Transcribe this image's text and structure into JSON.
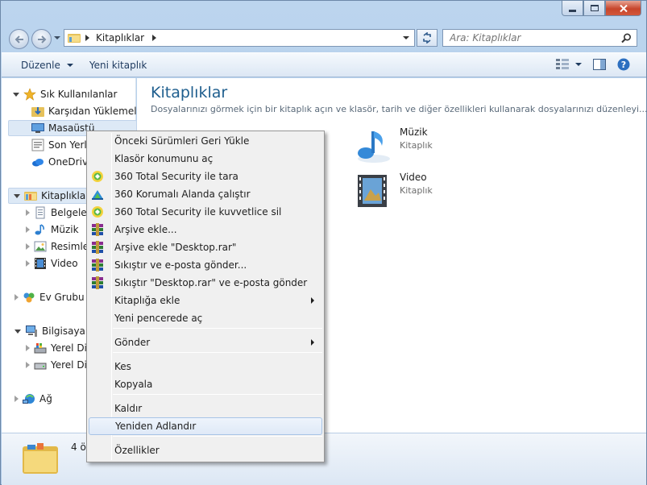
{
  "window": {
    "caption_buttons": [
      "minimize-icon",
      "maximize-icon",
      "close-icon"
    ]
  },
  "address": {
    "path": [
      "Kitaplıklar"
    ]
  },
  "search": {
    "placeholder": "Ara: Kitaplıklar"
  },
  "toolbar": {
    "organize_label": "Düzenle",
    "new_library_label": "Yeni kitaplık"
  },
  "nav": {
    "favorites_label": "Sık Kullanılanlar",
    "favorites_items": [
      "Karşıdan Yüklemeler",
      "Masaüstü",
      "Son Yerler",
      "OneDrive"
    ],
    "libraries_label": "Kitaplıklar",
    "libraries_items": [
      "Belgeler",
      "Müzik",
      "Resimler",
      "Video"
    ],
    "homegroup_label": "Ev Grubu",
    "computer_label": "Bilgisayar",
    "computer_items": [
      "Yerel Disk",
      "Yerel Disk"
    ],
    "network_label": "Ağ"
  },
  "main": {
    "title": "Kitaplıklar",
    "description": "Dosyalarınızı görmek için bir kitaplık açın ve klasör, tarih ve diğer özellikleri kullanarak dosyalarınızı düzenleyi...",
    "tiles": [
      {
        "name": "Müzik",
        "type": "Kitaplık",
        "icon": "music-library-icon"
      },
      {
        "name": "Video",
        "type": "Kitaplık",
        "icon": "video-library-icon"
      }
    ]
  },
  "status": {
    "text": "4 ö"
  },
  "context_menu": {
    "items": [
      {
        "label": "Önceki Sürümleri Geri Yükle",
        "icon": ""
      },
      {
        "label": "Klasör konumunu aç",
        "icon": ""
      },
      {
        "label": "360 Total Security ile tara",
        "icon": "360-security-icon"
      },
      {
        "label": "360 Korumalı Alanda çalıştır",
        "icon": "360-sandbox-icon"
      },
      {
        "label": "360 Total Security ile kuvvetlice sil",
        "icon": "360-security-icon"
      },
      {
        "label": "Arşive ekle...",
        "icon": "winrar-icon"
      },
      {
        "label": "Arşive ekle \"Desktop.rar\"",
        "icon": "winrar-icon"
      },
      {
        "label": "Sıkıştır ve e-posta gönder...",
        "icon": "winrar-icon"
      },
      {
        "label": "Sıkıştır \"Desktop.rar\" ve e-posta gönder",
        "icon": "winrar-icon"
      },
      {
        "label": "Kitaplığa ekle",
        "icon": "",
        "submenu": true
      },
      {
        "label": "Yeni pencerede aç",
        "icon": ""
      },
      {
        "label": "Gönder",
        "icon": "",
        "submenu": true
      },
      {
        "label": "Kes",
        "icon": ""
      },
      {
        "label": "Kopyala",
        "icon": ""
      },
      {
        "label": "Kaldır",
        "icon": ""
      },
      {
        "label": "Yeniden Adlandır",
        "icon": "",
        "hovered": true
      },
      {
        "label": "Özellikler",
        "icon": ""
      }
    ]
  }
}
